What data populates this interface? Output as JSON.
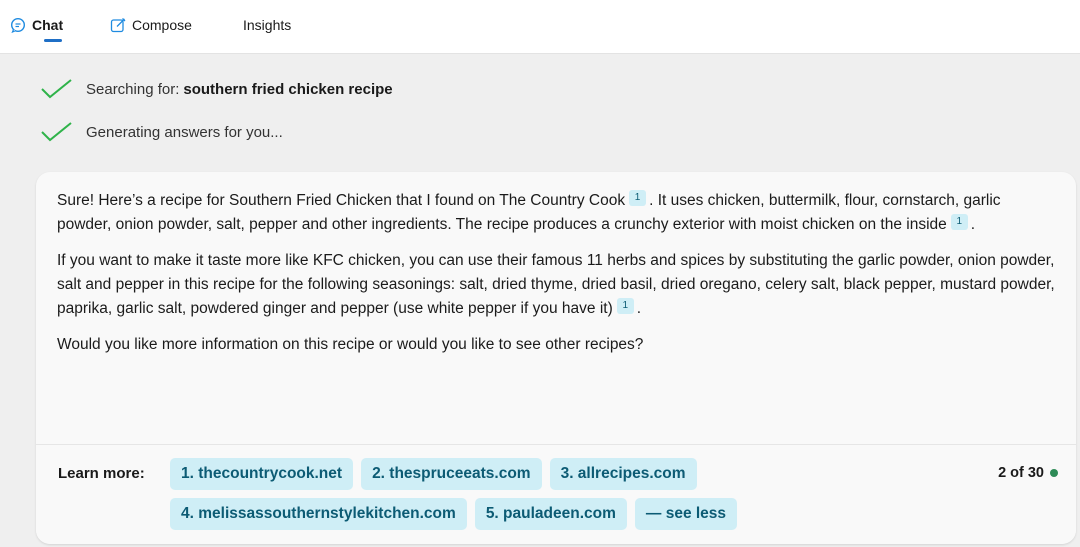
{
  "tabs": [
    {
      "label": "Chat",
      "icon": "chat-bubble-icon",
      "active": true
    },
    {
      "label": "Compose",
      "icon": "compose-edit-icon",
      "active": false
    },
    {
      "label": "Insights",
      "icon": null,
      "active": false
    }
  ],
  "status": [
    {
      "label": "Searching for:",
      "query": "southern fried chicken recipe",
      "icon": "check-icon"
    },
    {
      "label": "Generating answers for you...",
      "icon": "check-icon"
    }
  ],
  "answer": {
    "p1_a": "Sure! Here’s a recipe for Southern Fried Chicken that I found on The Country Cook",
    "p1_cite1": "1",
    "p1_b": ". It uses chicken, buttermilk, flour, cornstarch, garlic powder, onion powder, salt, pepper and other ingredients. The recipe produces a crunchy exterior with moist chicken on the inside",
    "p1_cite2": "1",
    "p1_c": ".",
    "p2_a": "If you want to make it taste more like KFC chicken, you can use their famous 11 herbs and spices by substituting the garlic powder, onion powder, salt and pepper in this recipe for the following seasonings: salt, dried thyme, dried basil, dried oregano, celery salt, black pepper, mustard powder, paprika, garlic salt, powdered ginger and pepper (use white pepper if you have it)",
    "p2_cite": "1",
    "p2_b": ".",
    "p3": "Would you like more information on this recipe or would you like to see other recipes?"
  },
  "learn_more": {
    "label": "Learn more:",
    "links": [
      "1. thecountrycook.net",
      "2. thespruceeats.com",
      "3. allrecipes.com",
      "4. melissassouthernstylekitchen.com",
      "5. pauladeen.com"
    ],
    "see_less": "— see less"
  },
  "counter": {
    "text": "2 of 30",
    "status_color": "#2e8b57"
  },
  "colors": {
    "accent": "#1f6fc6",
    "check": "#2fb34a",
    "chip_bg": "#cfeef6",
    "chip_text": "#0c5b74"
  }
}
